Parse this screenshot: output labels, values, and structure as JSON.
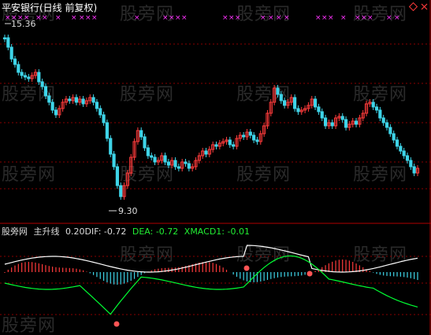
{
  "title": "平安银行(日线 前复权)",
  "price_marks": {
    "high": "15.36",
    "low": "9.30"
  },
  "indicator": {
    "site": "股旁网",
    "name": "主升线",
    "params": "0.20",
    "dif": "DIF: -0.72",
    "dea": "DEA: -0.72",
    "xmacd": "XMACD1: -0.01"
  },
  "watermark": "股旁网",
  "colors": {
    "background": "#000000",
    "up": "#ff3b3b",
    "down": "#3ed4e8",
    "divider": "#b00000",
    "grid": "#8a0000",
    "marker": "#ff33ff",
    "dif": "#ffffff",
    "dea": "#00ff33",
    "signal": "#ff5555"
  },
  "icons": [
    "restore-window-icon",
    "close-window-icon"
  ]
}
